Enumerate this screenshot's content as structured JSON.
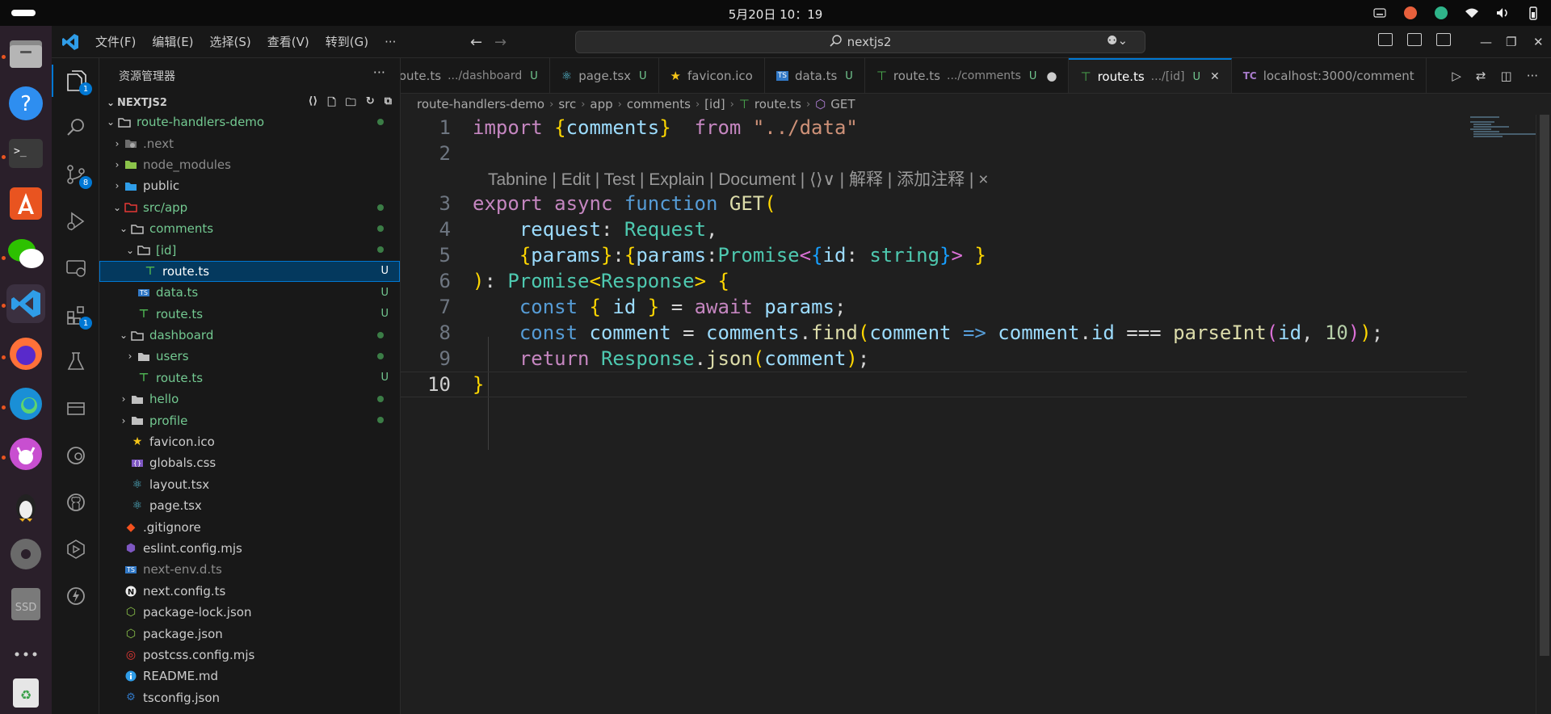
{
  "system": {
    "clock": "5月20日  10：19"
  },
  "dock": {
    "items": [
      "files-app",
      "help-app",
      "terminal-app",
      "app-center",
      "wechat-app",
      "vscode-app",
      "firefox-app",
      "edge-app",
      "cat-app",
      "linux-app",
      "disk-app",
      "ssd-drive",
      "show-apps",
      "trash-app"
    ],
    "ssd_label": "SSD"
  },
  "titlebar": {
    "menus": [
      "文件(F)",
      "编辑(E)",
      "选择(S)",
      "查看(V)",
      "转到(G)",
      "···"
    ],
    "search_text": "nextjs2"
  },
  "activity": {
    "explorer_badge": "1",
    "scm_badge": "8",
    "extensions_badge": "1"
  },
  "sidebar": {
    "title": "资源管理器",
    "project": "NEXTJS2",
    "tree": [
      {
        "name": "route-handlers-demo",
        "mark": "dot"
      },
      {
        "name": ".next",
        "mark": ""
      },
      {
        "name": "node_modules",
        "mark": ""
      },
      {
        "name": "public",
        "mark": ""
      },
      {
        "name": "src/app",
        "mark": "dot"
      },
      {
        "name": "comments",
        "mark": "dot"
      },
      {
        "name": "[id]",
        "mark": "dot"
      },
      {
        "name": "route.ts",
        "mark": "U"
      },
      {
        "name": "data.ts",
        "mark": "U"
      },
      {
        "name": "route.ts",
        "mark": "U"
      },
      {
        "name": "dashboard",
        "mark": "dot"
      },
      {
        "name": "users",
        "mark": "dot"
      },
      {
        "name": "route.ts",
        "mark": "U"
      },
      {
        "name": "hello",
        "mark": "dot"
      },
      {
        "name": "profile",
        "mark": "dot"
      },
      {
        "name": "favicon.ico",
        "mark": ""
      },
      {
        "name": "globals.css",
        "mark": ""
      },
      {
        "name": "layout.tsx",
        "mark": ""
      },
      {
        "name": "page.tsx",
        "mark": ""
      },
      {
        "name": ".gitignore",
        "mark": ""
      },
      {
        "name": "eslint.config.mjs",
        "mark": ""
      },
      {
        "name": "next-env.d.ts",
        "mark": ""
      },
      {
        "name": "next.config.ts",
        "mark": ""
      },
      {
        "name": "package-lock.json",
        "mark": ""
      },
      {
        "name": "package.json",
        "mark": ""
      },
      {
        "name": "postcss.config.mjs",
        "mark": ""
      },
      {
        "name": "README.md",
        "mark": ""
      },
      {
        "name": "tsconfig.json",
        "mark": ""
      }
    ]
  },
  "tabs": [
    {
      "name": "route.ts",
      "desc": ".../dashboard",
      "mark": "U"
    },
    {
      "name": "page.tsx",
      "desc": "",
      "mark": "U"
    },
    {
      "name": "favicon.ico",
      "desc": "",
      "mark": ""
    },
    {
      "name": "data.ts",
      "desc": "",
      "mark": "U"
    },
    {
      "name": "route.ts",
      "desc": ".../comments",
      "mark": "U"
    },
    {
      "name": "route.ts",
      "desc": ".../[id]",
      "mark": "U"
    },
    {
      "name": "localhost:3000/comment",
      "desc": "",
      "mark": ""
    }
  ],
  "tab_icons": {
    "tc": "TC"
  },
  "breadcrumbs": [
    "route-handlers-demo",
    "src",
    "app",
    "comments",
    "[id]",
    "route.ts",
    "GET"
  ],
  "editor": {
    "line_numbers": [
      "1",
      "2",
      "3",
      "4",
      "5",
      "6",
      "7",
      "8",
      "9",
      "10"
    ],
    "codelens": "Tabnine | Edit | Test | Explain | Document | ⟨⟩∨ | 解释 | 添加注释 | ×",
    "lines": [
      "import {comments}  from \"../data\"",
      "",
      "export async function GET(",
      "    request: Request,",
      "    {params}:{params:Promise<{id: string}> }",
      "): Promise<Response> {",
      "    const { id } = await params;",
      "    const comment = comments.find(comment => comment.id === parseInt(id, 10));",
      "    return Response.json(comment);",
      "}"
    ]
  },
  "colors": {
    "accent": "#0078d4",
    "untracked": "#73c991",
    "keyword": "#c586c0",
    "function": "#dcdcaa",
    "type": "#4ec9b0",
    "string": "#ce9178"
  }
}
